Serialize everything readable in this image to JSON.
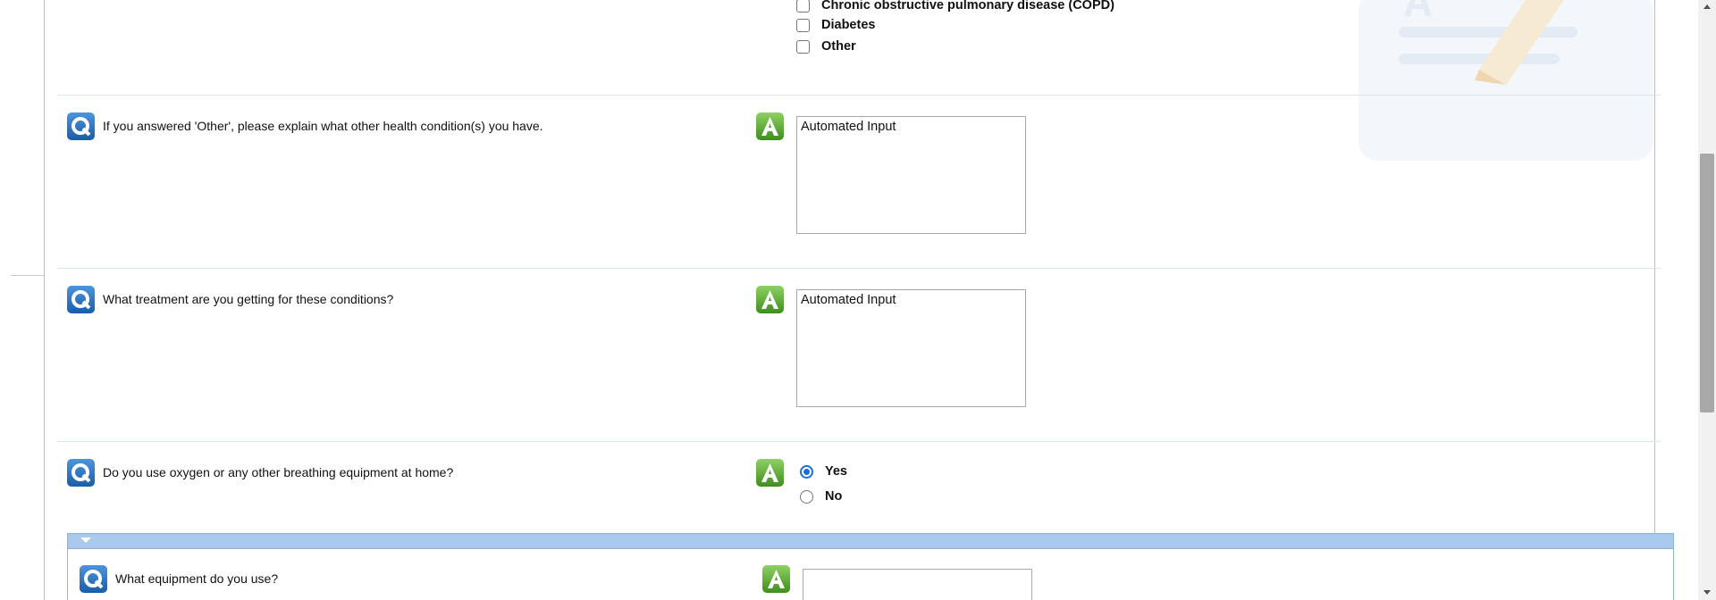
{
  "conditions": {
    "options": [
      {
        "label": "Chronic obstructive pulmonary disease (COPD)",
        "checked": false
      },
      {
        "label": "Diabetes",
        "checked": false
      },
      {
        "label": "Other",
        "checked": false
      }
    ]
  },
  "questions": [
    {
      "text": "If you answered 'Other', please explain what other health condition(s) you have.",
      "answer": "Automated Input"
    },
    {
      "text": "What treatment are you getting for these conditions?",
      "answer": "Automated Input"
    },
    {
      "text": "Do you use oxygen or any other breathing equipment at home?",
      "options": [
        "Yes",
        "No"
      ],
      "selected": "Yes"
    }
  ],
  "subsection": {
    "question": {
      "text": "What equipment do you use?",
      "answer": ""
    }
  },
  "icons": {
    "question": "question-icon",
    "answer": "answer-icon"
  },
  "colors": {
    "question_icon": "#2a6dba",
    "answer_icon": "#5aa832",
    "subsection_header": "#a8c9ea",
    "radio_selected": "#1a6fd6"
  }
}
